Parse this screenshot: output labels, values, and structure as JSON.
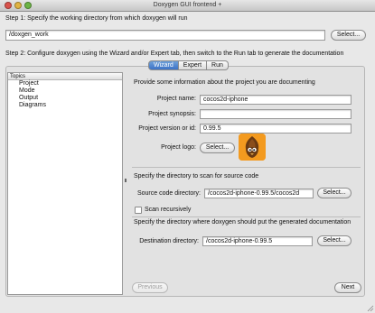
{
  "window": {
    "title": "Doxygen GUI frontend +"
  },
  "step1": {
    "label": "Step 1: Specify the working directory from which doxygen will run",
    "dir_value": "/doxgen_work",
    "select_label": "Select..."
  },
  "step2": {
    "label": "Step 2: Configure doxygen using the Wizard and/or Expert tab, then switch to the Run tab to generate the documentation"
  },
  "tabs": [
    {
      "label": "Wizard",
      "active": true
    },
    {
      "label": "Expert",
      "active": false
    },
    {
      "label": "Run",
      "active": false
    }
  ],
  "topics": {
    "header": "Topics",
    "items": [
      "Project",
      "Mode",
      "Output",
      "Diagrams"
    ]
  },
  "project": {
    "intro": "Provide some information about the project you are documenting",
    "name_label": "Project name:",
    "name_value": "cocos2d-iphone",
    "synopsis_label": "Project synopsis:",
    "synopsis_value": "",
    "version_label": "Project version or id:",
    "version_value": "0.99.5",
    "logo_label": "Project logo:",
    "logo_select_label": "Select..."
  },
  "source": {
    "intro": "Specify the directory to scan for source code",
    "dir_label": "Source code directory:",
    "dir_value": "/cocos2d-iphone-0.99.5/cocos2d",
    "select_label": "Select...",
    "recursive_label": "Scan recursively",
    "recursive_checked": false
  },
  "dest": {
    "intro": "Specify the directory where doxygen should put the generated documentation",
    "dir_label": "Destination directory:",
    "dir_value": "/cocos2d-iphone-0.99.5",
    "select_label": "Select..."
  },
  "nav": {
    "previous_label": "Previous",
    "next_label": "Next"
  },
  "colors": {
    "tab_active": "#3d73c6",
    "logo_bg": "#f39a1f"
  }
}
